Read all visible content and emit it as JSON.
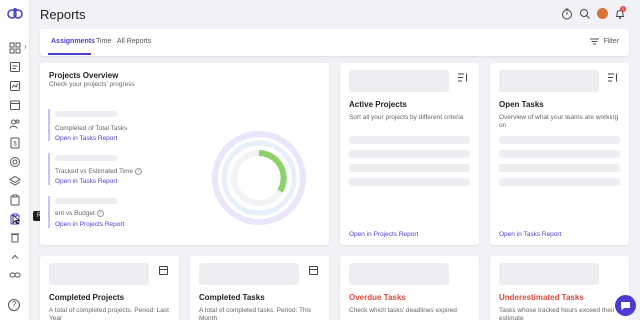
{
  "header": {
    "title": "Reports",
    "notification_count": "1"
  },
  "tabs": [
    {
      "label": "Assignments",
      "active": true
    },
    {
      "label": "Time",
      "active": false
    },
    {
      "label": "All Reports",
      "active": false
    }
  ],
  "filter_label": "Filter",
  "sidebar": {
    "tooltip": "Reports"
  },
  "colors": {
    "accent": "#4d3fcf",
    "warning_red": "#d94b3d",
    "progress_green": "#8cd36a"
  },
  "projects_overview": {
    "title": "Projects Overview",
    "subtitle": "Check your projects' progress",
    "metrics": [
      {
        "label": "Completed of Total Tasks",
        "link": "Open in Tasks Report"
      },
      {
        "label": "Tracked vs Estimated Time",
        "link": "Open in Tasks Report"
      },
      {
        "label": "ent vs Budget",
        "link": "Open in Projects Report"
      }
    ]
  },
  "active_projects": {
    "title": "Active Projects",
    "subtitle": "Sort all your projects by different criteria",
    "link": "Open in Projects Report"
  },
  "open_tasks": {
    "title": "Open Tasks",
    "subtitle": "Overview of what your teams are working on",
    "link": "Open in Tasks Report"
  },
  "bottom_cards": [
    {
      "title": "Completed Projects",
      "subtitle": "A total of completed projects. Period: Last Year"
    },
    {
      "title": "Completed Tasks",
      "subtitle": "A total of completed tasks. Period: This Month"
    },
    {
      "title": "Overdue Tasks",
      "subtitle": "Check which tasks' deadlines expired"
    },
    {
      "title": "Underestimated Tasks",
      "subtitle": "Tasks whose tracked hours exceed their estimate"
    }
  ]
}
